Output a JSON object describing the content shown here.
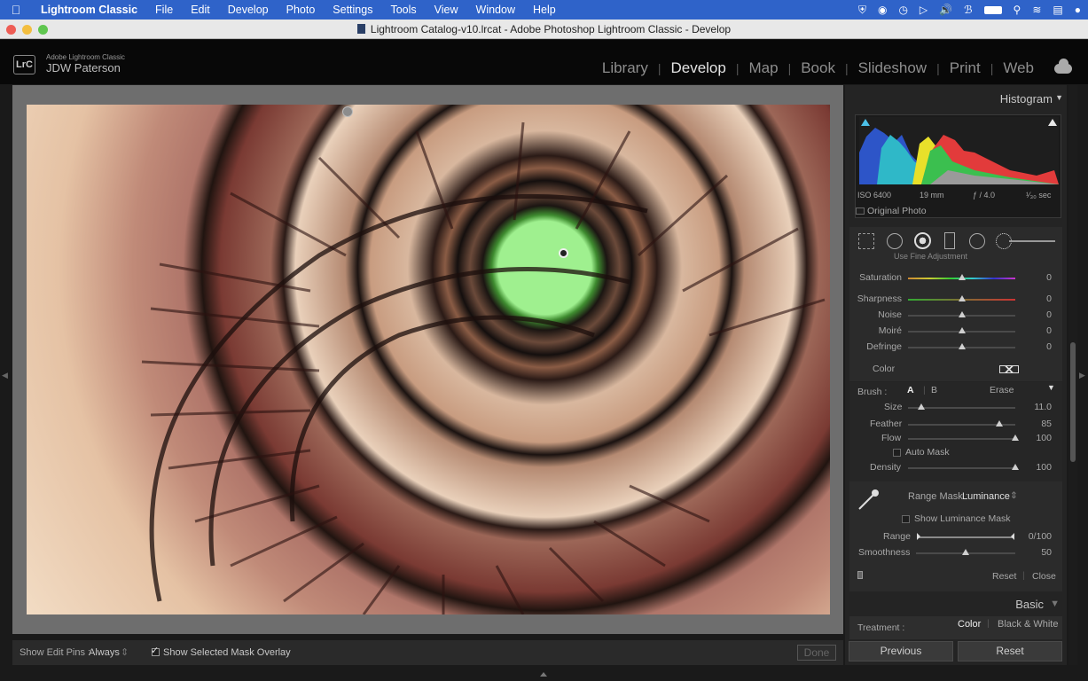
{
  "menubar": {
    "app": "Lightroom Classic",
    "items": [
      "File",
      "Edit",
      "Develop",
      "Photo",
      "Settings",
      "Tools",
      "View",
      "Window",
      "Help"
    ]
  },
  "window": {
    "title": "Lightroom Catalog-v10.lrcat - Adobe Photoshop Lightroom Classic - Develop"
  },
  "identity": {
    "logo": "LrC",
    "product": "Adobe Lightroom Classic",
    "user": "JDW Paterson"
  },
  "modules": [
    "Library",
    "Develop",
    "Map",
    "Book",
    "Slideshow",
    "Print",
    "Web"
  ],
  "active_module": "Develop",
  "toolbar": {
    "edit_pins_label": "Show Edit Pins :",
    "edit_pins_value": "Always",
    "mask_overlay": "Show Selected Mask Overlay",
    "done": "Done"
  },
  "histogram": {
    "title": "Histogram",
    "iso": "ISO 6400",
    "focal": "19 mm",
    "aperture": "ƒ / 4.0",
    "shutter": "¹⁄₃₀ sec",
    "original_photo": "Original Photo"
  },
  "effects": {
    "partial": "Use Fine Adjustment",
    "rows": [
      {
        "label": "Saturation",
        "value": "0",
        "level": 0.5
      },
      {
        "label": "Sharpness",
        "value": "0",
        "level": 0.5
      },
      {
        "label": "Noise",
        "value": "0",
        "level": 0.5
      },
      {
        "label": "Moiré",
        "value": "0",
        "level": 0.5
      },
      {
        "label": "Defringe",
        "value": "0",
        "level": 0.5
      }
    ],
    "color_label": "Color"
  },
  "brush": {
    "label": "Brush :",
    "a": "A",
    "b": "B",
    "erase": "Erase",
    "size_label": "Size",
    "size_value": "11.0",
    "size_level": 0.12,
    "feather_label": "Feather",
    "feather_value": "85",
    "feather_level": 0.85,
    "flow_label": "Flow",
    "flow_value": "100",
    "flow_level": 1.0,
    "automask_label": "Auto Mask",
    "density_label": "Density",
    "density_value": "100",
    "density_level": 1.0
  },
  "range_mask": {
    "label": "Range Mask :",
    "value": "Luminance",
    "show_mask": "Show Luminance Mask",
    "range_label": "Range",
    "range_value": "0/100",
    "smooth_label": "Smoothness",
    "smooth_value": "50",
    "smooth_level": 0.5,
    "reset": "Reset",
    "close": "Close"
  },
  "basic": {
    "title": "Basic",
    "treatment_label": "Treatment :",
    "color": "Color",
    "bw": "Black & White"
  },
  "footer": {
    "previous": "Previous",
    "reset": "Reset"
  }
}
